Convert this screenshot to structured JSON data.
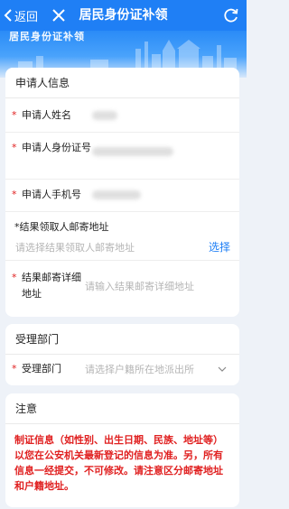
{
  "header": {
    "back_label": "返回",
    "title": "居民身份证补领"
  },
  "banner": {
    "text": "居民身份证补领"
  },
  "applicant": {
    "section_title": "申请人信息",
    "name_label": "申请人姓名",
    "id_label": "申请人身份证号",
    "phone_label": "申请人手机号",
    "address_title": "*结果领取人邮寄地址",
    "address_placeholder": "请选择结果领取人邮寄地址",
    "select_label": "选择",
    "detail_label": "结果邮寄详细地址",
    "detail_placeholder": "请输入结果邮寄详细地址"
  },
  "department": {
    "section_title": "受理部门",
    "field_label": "受理部门",
    "field_placeholder": "请选择户籍所在地派出所"
  },
  "notice": {
    "section_title": "注意",
    "text": "制证信息（如性别、出生日期、民族、地址等）以您在公安机关最新登记的信息为准。另，所有信息一经提交，不可修改。请注意区分邮寄地址和户籍地址。"
  },
  "colors": {
    "primary": "#1f7ff5",
    "warning": "#e02020"
  },
  "icons": [
    "back-arrow-icon",
    "close-icon",
    "refresh-icon",
    "chevron-down-icon"
  ]
}
